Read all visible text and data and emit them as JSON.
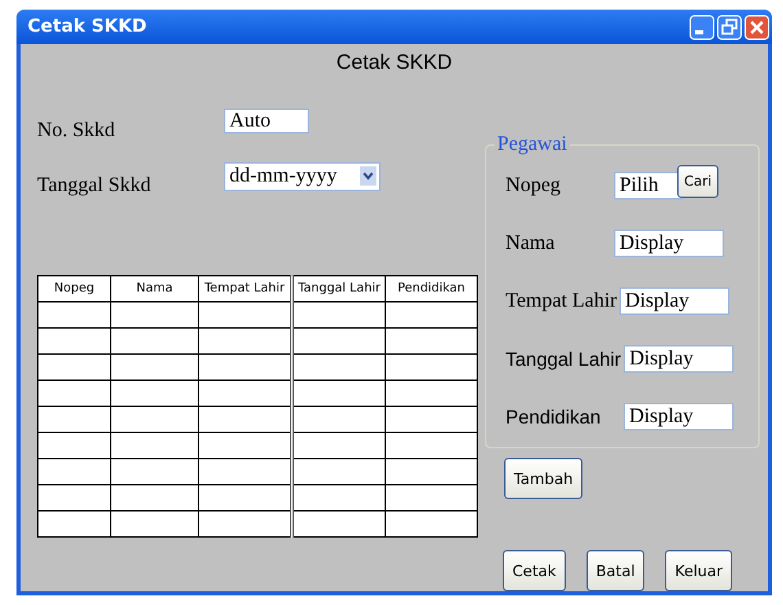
{
  "window": {
    "title": "Cetak SKKD"
  },
  "heading": "Cetak SKKD",
  "form": [
    {
      "label": "No. Skkd",
      "kind": "text",
      "value": "Auto"
    },
    {
      "label": "Tanggal Skkd",
      "kind": "select",
      "value": "dd-mm-yyyy"
    }
  ],
  "table": {
    "columns": [
      "Nopeg",
      "Nama",
      "Tempat Lahir",
      "Tanggal Lahir",
      "Pendidikan"
    ]
  },
  "pegawai": {
    "title": "Pegawai",
    "fields": [
      {
        "label": "Nopeg",
        "value": "Pilih",
        "button": "Cari"
      },
      {
        "label": "Nama",
        "value": "Display"
      },
      {
        "label": "Tempat Lahir",
        "value": "Display"
      },
      {
        "label": "Tanggal Lahir",
        "value": "Display"
      },
      {
        "label": "Pendidikan",
        "value": "Display"
      }
    ]
  },
  "add_button": "Tambah",
  "buttons": [
    "Cetak",
    "Batal",
    "Keluar"
  ]
}
